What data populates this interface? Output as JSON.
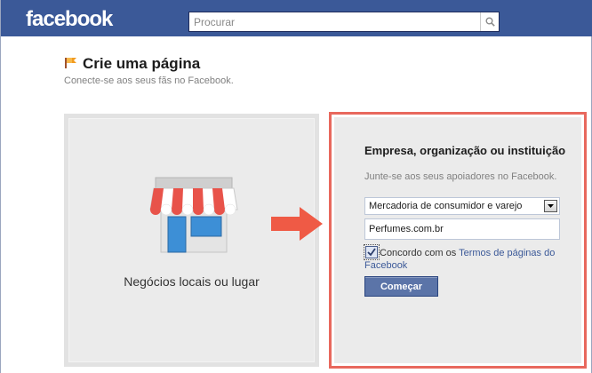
{
  "header": {
    "logo_text": "facebook",
    "search_placeholder": "Procurar"
  },
  "page": {
    "title": "Crie uma página",
    "subtitle": "Conecte-se aos seus fãs no Facebook."
  },
  "left_card": {
    "label": "Negócios locais ou lugar",
    "icon": "storefront-icon"
  },
  "right_card": {
    "title": "Empresa, organização ou instituição",
    "subtitle": "Junte-se aos seus apoiadores no Facebook.",
    "category_selected": "Mercadoria de consumidor e varejo",
    "name_value": "Perfumes.com.br",
    "agree_checked": true,
    "agree_prefix": "Concordo com os ",
    "agree_link": "Termos de páginas do Facebook",
    "start_label": "Começar",
    "highlight_color": "#e8685d"
  },
  "colors": {
    "brand": "#3b5998",
    "arrow": "#ef5a45"
  }
}
